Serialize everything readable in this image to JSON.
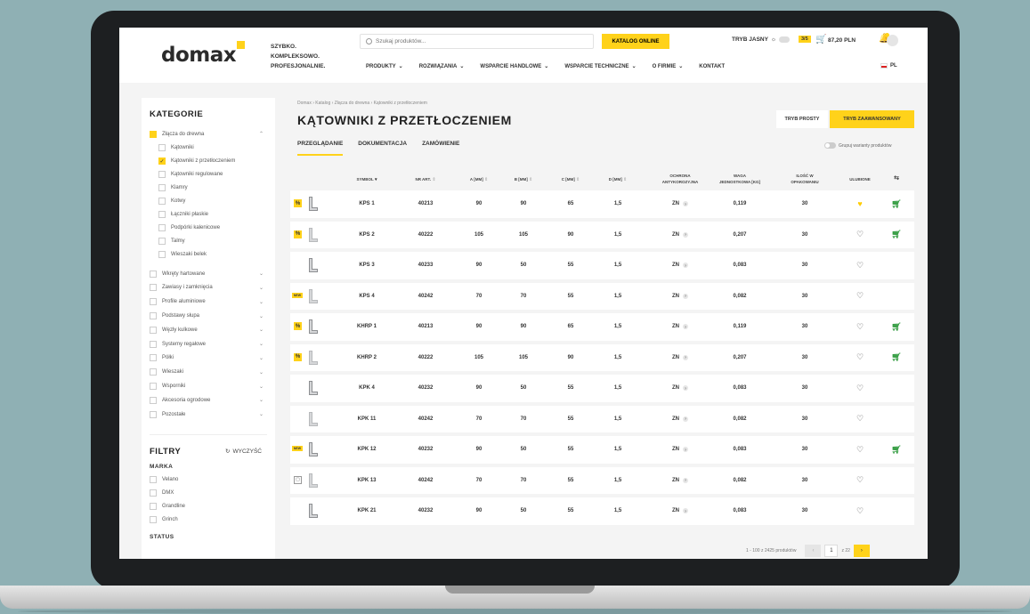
{
  "header": {
    "logo": "domax",
    "tagline": [
      "SZYBKO.",
      "KOMPLEKSOWO.",
      "PROFESJONALNIE."
    ],
    "search_placeholder": "Szukaj produktów...",
    "catalog_button": "KATALOG ONLINE",
    "light_mode": "TRYB JASNY",
    "cart_badge": "3/5",
    "cart_total": "87,20 PLN",
    "nav": [
      "PRODUKTY",
      "ROZWIĄZANIA",
      "WSPARCIE HANDLOWE",
      "WSPARCIE TECHNICZNE",
      "O FIRMIE",
      "KONTAKT"
    ],
    "language": "PL"
  },
  "sidebar": {
    "categories_title": "KATEGORIE",
    "top_category": "Złącza do drewna",
    "subcategories": [
      {
        "label": "Kątowniki",
        "checked": false
      },
      {
        "label": "Kątowniki z przetłoczeniem",
        "checked": true
      },
      {
        "label": "Kątowniki regulowane",
        "checked": false
      },
      {
        "label": "Klamry",
        "checked": false
      },
      {
        "label": "Kotwy",
        "checked": false
      },
      {
        "label": "Łączniki płaskie",
        "checked": false
      },
      {
        "label": "Podpórki kalenicowe",
        "checked": false
      },
      {
        "label": "Talmy",
        "checked": false
      },
      {
        "label": "Wieszaki belek",
        "checked": false
      }
    ],
    "categories": [
      "Wkręty hartowane",
      "Zawiasy i zamknięcia",
      "Profile aluminiowe",
      "Podstawy słupa",
      "Węzły kulkowe",
      "Systemy regałowe",
      "Półki",
      "Wieszaki",
      "Wsporniki",
      "Akcesoria ogrodowe",
      "Pozostałe"
    ],
    "filters_title": "FILTRY",
    "clear_label": "WYCZYŚĆ",
    "brand_title": "MARKA",
    "brands": [
      "Velano",
      "DMX",
      "Grandline",
      "Grinch"
    ],
    "status_title": "STATUS"
  },
  "main": {
    "breadcrumb": "Domax  ›  Katalog  ›  Złącza do drewna  ›  Kątowniki z przetłoczeniem",
    "title": "KĄTOWNIKI Z PRZETŁOCZENIEM",
    "mode_simple": "TRYB PROSTY",
    "mode_advanced": "TRYB ZAAWANSOWANY",
    "tabs": [
      "PRZEGLĄDANIE",
      "DOKUMENTACJA",
      "ZAMÓWIENIE"
    ],
    "group_variants": "Grupuj warianty produktów",
    "columns": [
      "SYMBOL",
      "NR ART.",
      "A [MM]",
      "B [MM]",
      "C [MM]",
      "D [MM]",
      "OCHRONA|ANTYKOROZYJNA",
      "WAGA|JEDNOSTKOWA [KG]",
      "ILOŚĆ W|OPAKOWANIU",
      "ULUBIONE"
    ],
    "rows": [
      {
        "badge": "sale",
        "symbol": "KPS 1",
        "nr": "40213",
        "a": "90",
        "b": "90",
        "c": "65",
        "d": "1,5",
        "zn": "ZN",
        "weight": "0,119",
        "qty": "30",
        "fav": true,
        "cart": true
      },
      {
        "badge": "sale",
        "symbol": "KPS 2",
        "nr": "40222",
        "a": "105",
        "b": "105",
        "c": "90",
        "d": "1,5",
        "zn": "ZN",
        "weight": "0,207",
        "qty": "30",
        "fav": false,
        "cart": true
      },
      {
        "badge": "",
        "symbol": "KPS 3",
        "nr": "40233",
        "a": "90",
        "b": "50",
        "c": "55",
        "d": "1,5",
        "zn": "ZN",
        "weight": "0,083",
        "qty": "30",
        "fav": false,
        "cart": false
      },
      {
        "badge": "new",
        "symbol": "KPS 4",
        "nr": "40242",
        "a": "70",
        "b": "70",
        "c": "55",
        "d": "1,5",
        "zn": "ZN",
        "weight": "0,082",
        "qty": "30",
        "fav": false,
        "cart": false
      },
      {
        "badge": "sale",
        "symbol": "KHRP 1",
        "nr": "40213",
        "a": "90",
        "b": "90",
        "c": "65",
        "d": "1,5",
        "zn": "ZN",
        "weight": "0,119",
        "qty": "30",
        "fav": false,
        "cart": true
      },
      {
        "badge": "sale",
        "symbol": "KHRP 2",
        "nr": "40222",
        "a": "105",
        "b": "105",
        "c": "90",
        "d": "1,5",
        "zn": "ZN",
        "weight": "0,207",
        "qty": "30",
        "fav": false,
        "cart": true
      },
      {
        "badge": "",
        "symbol": "KPK 4",
        "nr": "40232",
        "a": "90",
        "b": "50",
        "c": "55",
        "d": "1,5",
        "zn": "ZN",
        "weight": "0,083",
        "qty": "30",
        "fav": false,
        "cart": false
      },
      {
        "badge": "",
        "symbol": "KPK 11",
        "nr": "40242",
        "a": "70",
        "b": "70",
        "c": "55",
        "d": "1,5",
        "zn": "ZN",
        "weight": "0,082",
        "qty": "30",
        "fav": false,
        "cart": false
      },
      {
        "badge": "new",
        "symbol": "KPK 12",
        "nr": "40232",
        "a": "90",
        "b": "50",
        "c": "55",
        "d": "1,5",
        "zn": "ZN",
        "weight": "0,083",
        "qty": "30",
        "fav": false,
        "cart": true
      },
      {
        "badge": "doc",
        "symbol": "KPK 13",
        "nr": "40242",
        "a": "70",
        "b": "70",
        "c": "55",
        "d": "1,5",
        "zn": "ZN",
        "weight": "0,082",
        "qty": "30",
        "fav": false,
        "cart": false
      },
      {
        "badge": "",
        "symbol": "KPK 21",
        "nr": "40232",
        "a": "90",
        "b": "50",
        "c": "55",
        "d": "1,5",
        "zn": "ZN",
        "weight": "0,083",
        "qty": "30",
        "fav": false,
        "cart": false
      }
    ],
    "badge_sale": "%",
    "badge_new": "NEW",
    "badge_doc": "▢",
    "zn_info": "?",
    "pager_info": "1 - 100 z 2425 produktów",
    "pager_page": "1",
    "pager_total": "z 22"
  },
  "colors": {
    "accent": "#ffd21a",
    "cart_green": "#2e9a3c",
    "background": "#8fb0b4"
  }
}
